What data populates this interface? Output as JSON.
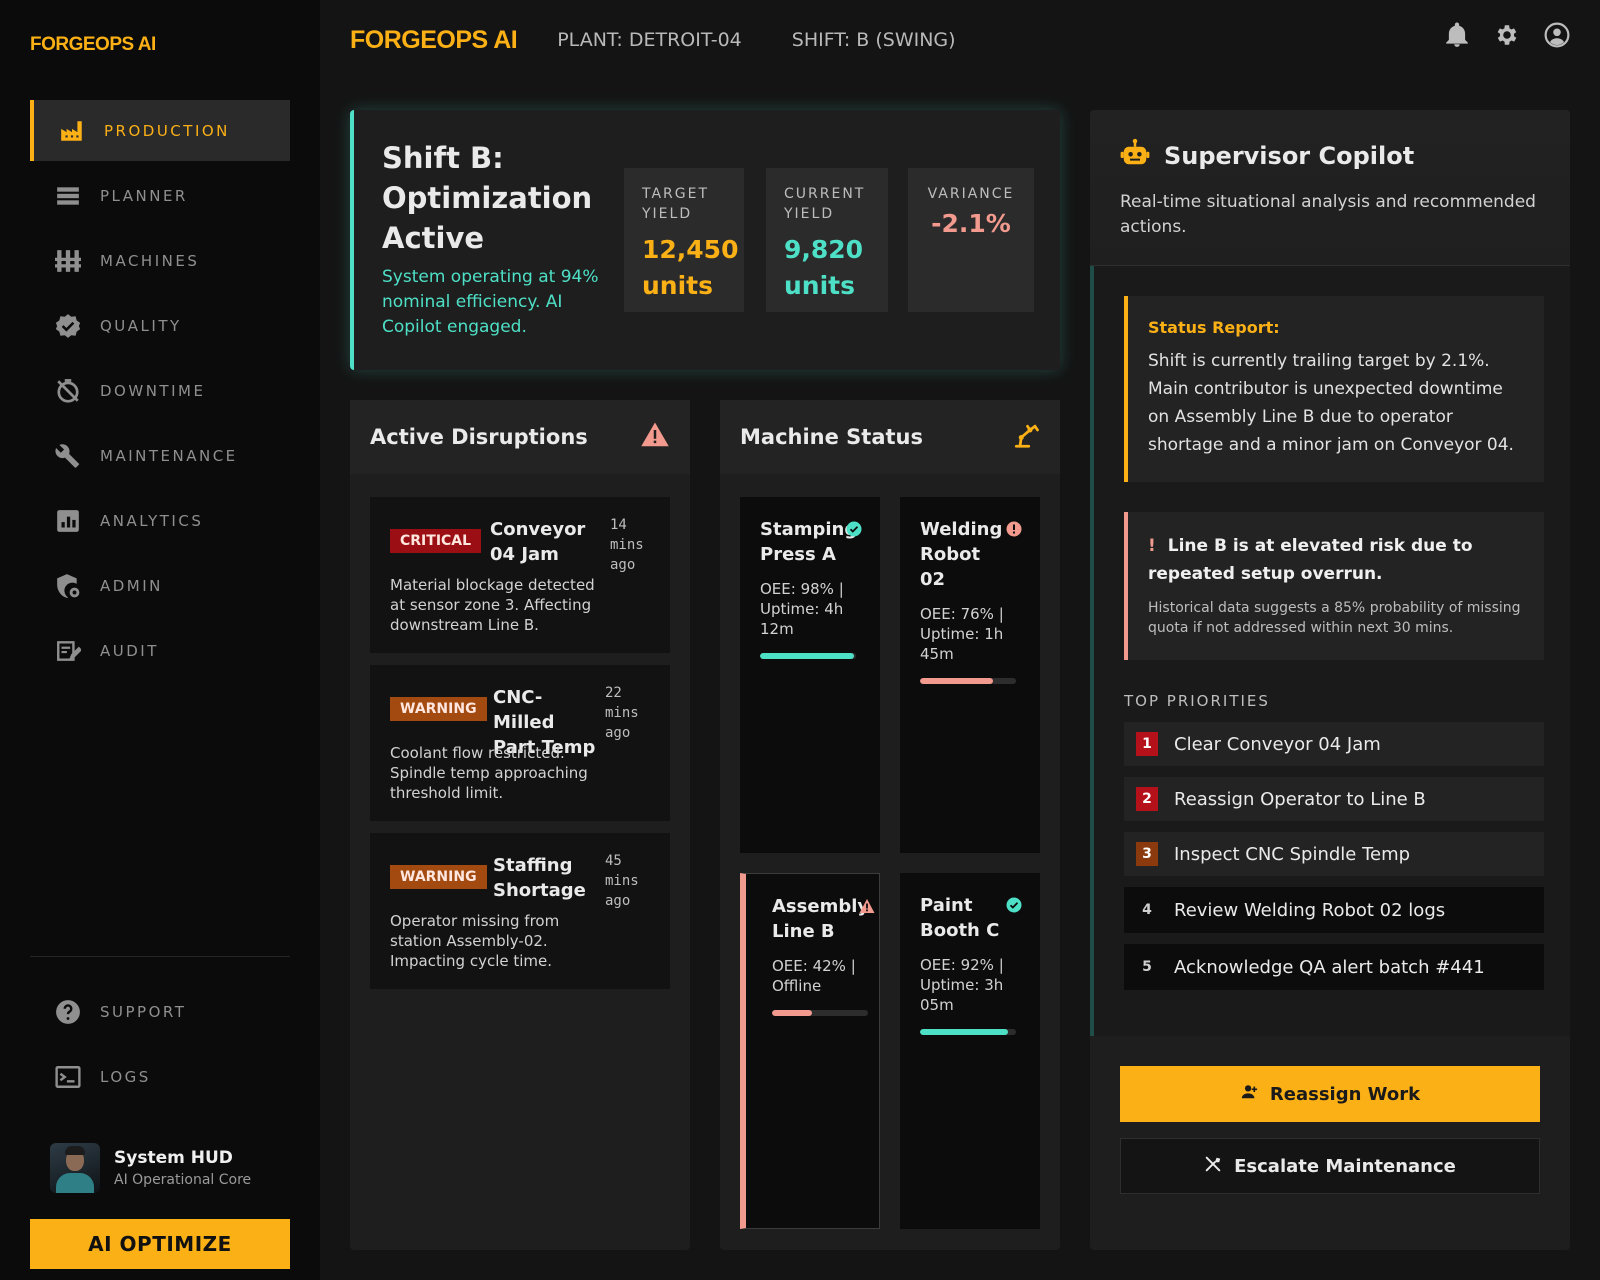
{
  "sidebar": {
    "brand": "FORGEOPS AI",
    "nav": [
      {
        "label": "PRODUCTION",
        "icon": "factory-icon",
        "active": true
      },
      {
        "label": "PLANNER",
        "icon": "planner-icon"
      },
      {
        "label": "MACHINES",
        "icon": "machines-icon"
      },
      {
        "label": "QUALITY",
        "icon": "quality-badge-icon"
      },
      {
        "label": "DOWNTIME",
        "icon": "timer-off-icon"
      },
      {
        "label": "MAINTENANCE",
        "icon": "wrench-icon"
      },
      {
        "label": "ANALYTICS",
        "icon": "analytics-icon"
      },
      {
        "label": "ADMIN",
        "icon": "shield-gear-icon"
      },
      {
        "label": "AUDIT",
        "icon": "audit-icon"
      }
    ],
    "bottom": [
      {
        "label": "SUPPORT",
        "icon": "help-icon"
      },
      {
        "label": "LOGS",
        "icon": "terminal-icon"
      }
    ],
    "user": {
      "name": "System HUD",
      "role": "AI Operational Core"
    },
    "optimize_label": "AI OPTIMIZE"
  },
  "header": {
    "brand": "FORGEOPS AI",
    "plant": "PLANT: DETROIT-04",
    "shift": "SHIFT: B (SWING)",
    "icons": [
      "bell-icon",
      "gear-icon",
      "account-icon"
    ]
  },
  "hero": {
    "title": "Shift B: Optimization Active",
    "subtitle": "System operating at 94% nominal efficiency. AI Copilot engaged.",
    "stats": {
      "target": {
        "label": "TARGET YIELD",
        "value": "12,450 units"
      },
      "current": {
        "label": "CURRENT YIELD",
        "value": "9,820 units"
      },
      "variance": {
        "label": "VARIANCE",
        "value": "-2.1%"
      }
    }
  },
  "disruptions": {
    "title": "Active Disruptions",
    "items": [
      {
        "badge": "CRITICAL",
        "title": "Conveyor 04 Jam",
        "time": "14 mins ago",
        "desc": "Material blockage detected at sensor zone 3. Affecting downstream Line B."
      },
      {
        "badge": "WARNING",
        "title": "CNC-Milled Part Temp",
        "time": "22 mins ago",
        "desc": "Coolant flow restricted. Spindle temp approaching threshold limit."
      },
      {
        "badge": "WARNING",
        "title": "Staffing Shortage",
        "time": "45 mins ago",
        "desc": "Operator missing from station Assembly-02. Impacting cycle time."
      }
    ]
  },
  "machines": {
    "title": "Machine Status",
    "items": [
      {
        "name": "Stamping Press A",
        "info": "OEE: 98% | Uptime: 4h 12m",
        "status": "ok",
        "level": 0.98,
        "color": "#4ee0c6"
      },
      {
        "name": "Welding Robot 02",
        "info": "OEE: 76% | Uptime: 1h 45m",
        "status": "warn",
        "level": 0.76,
        "color": "#f29a8e"
      },
      {
        "name": "Assembly Line B",
        "info": "OEE: 42% | Offline",
        "status": "alert",
        "level": 0.42,
        "color": "#f29a8e"
      },
      {
        "name": "Paint Booth C",
        "info": "OEE: 92% | Uptime: 3h 05m",
        "status": "ok",
        "level": 0.92,
        "color": "#4ee0c6"
      }
    ]
  },
  "copilot": {
    "title": "Supervisor Copilot",
    "subtitle": "Real-time situational analysis and recommended actions.",
    "report_title": "Status Report:",
    "report_text": "Shift is currently trailing target by 2.1%. Main contributor is unexpected downtime on Assembly Line B due to operator shortage and a minor jam on Conveyor 04.",
    "risk_title": "Line B is at elevated risk due to repeated setup overrun.",
    "risk_text": "Historical data suggests a 85% probability of missing quota if not addressed within next 30 mins.",
    "priorities_label": "TOP PRIORITIES",
    "priorities": [
      {
        "num": "1",
        "label": "Clear Conveyor 04 Jam"
      },
      {
        "num": "2",
        "label": "Reassign Operator to Line B"
      },
      {
        "num": "3",
        "label": "Inspect CNC Spindle Temp"
      },
      {
        "num": "4",
        "label": "Review Welding Robot 02 logs"
      },
      {
        "num": "5",
        "label": "Acknowledge QA alert batch #441"
      }
    ],
    "reassign_label": "Reassign Work",
    "escalate_label": "Escalate Maintenance"
  },
  "colors": {
    "accent": "#fbb016",
    "ok": "#4ee0c6",
    "alert": "#f29a8e",
    "critical": "#9b0f14",
    "warning": "#a34a10"
  }
}
